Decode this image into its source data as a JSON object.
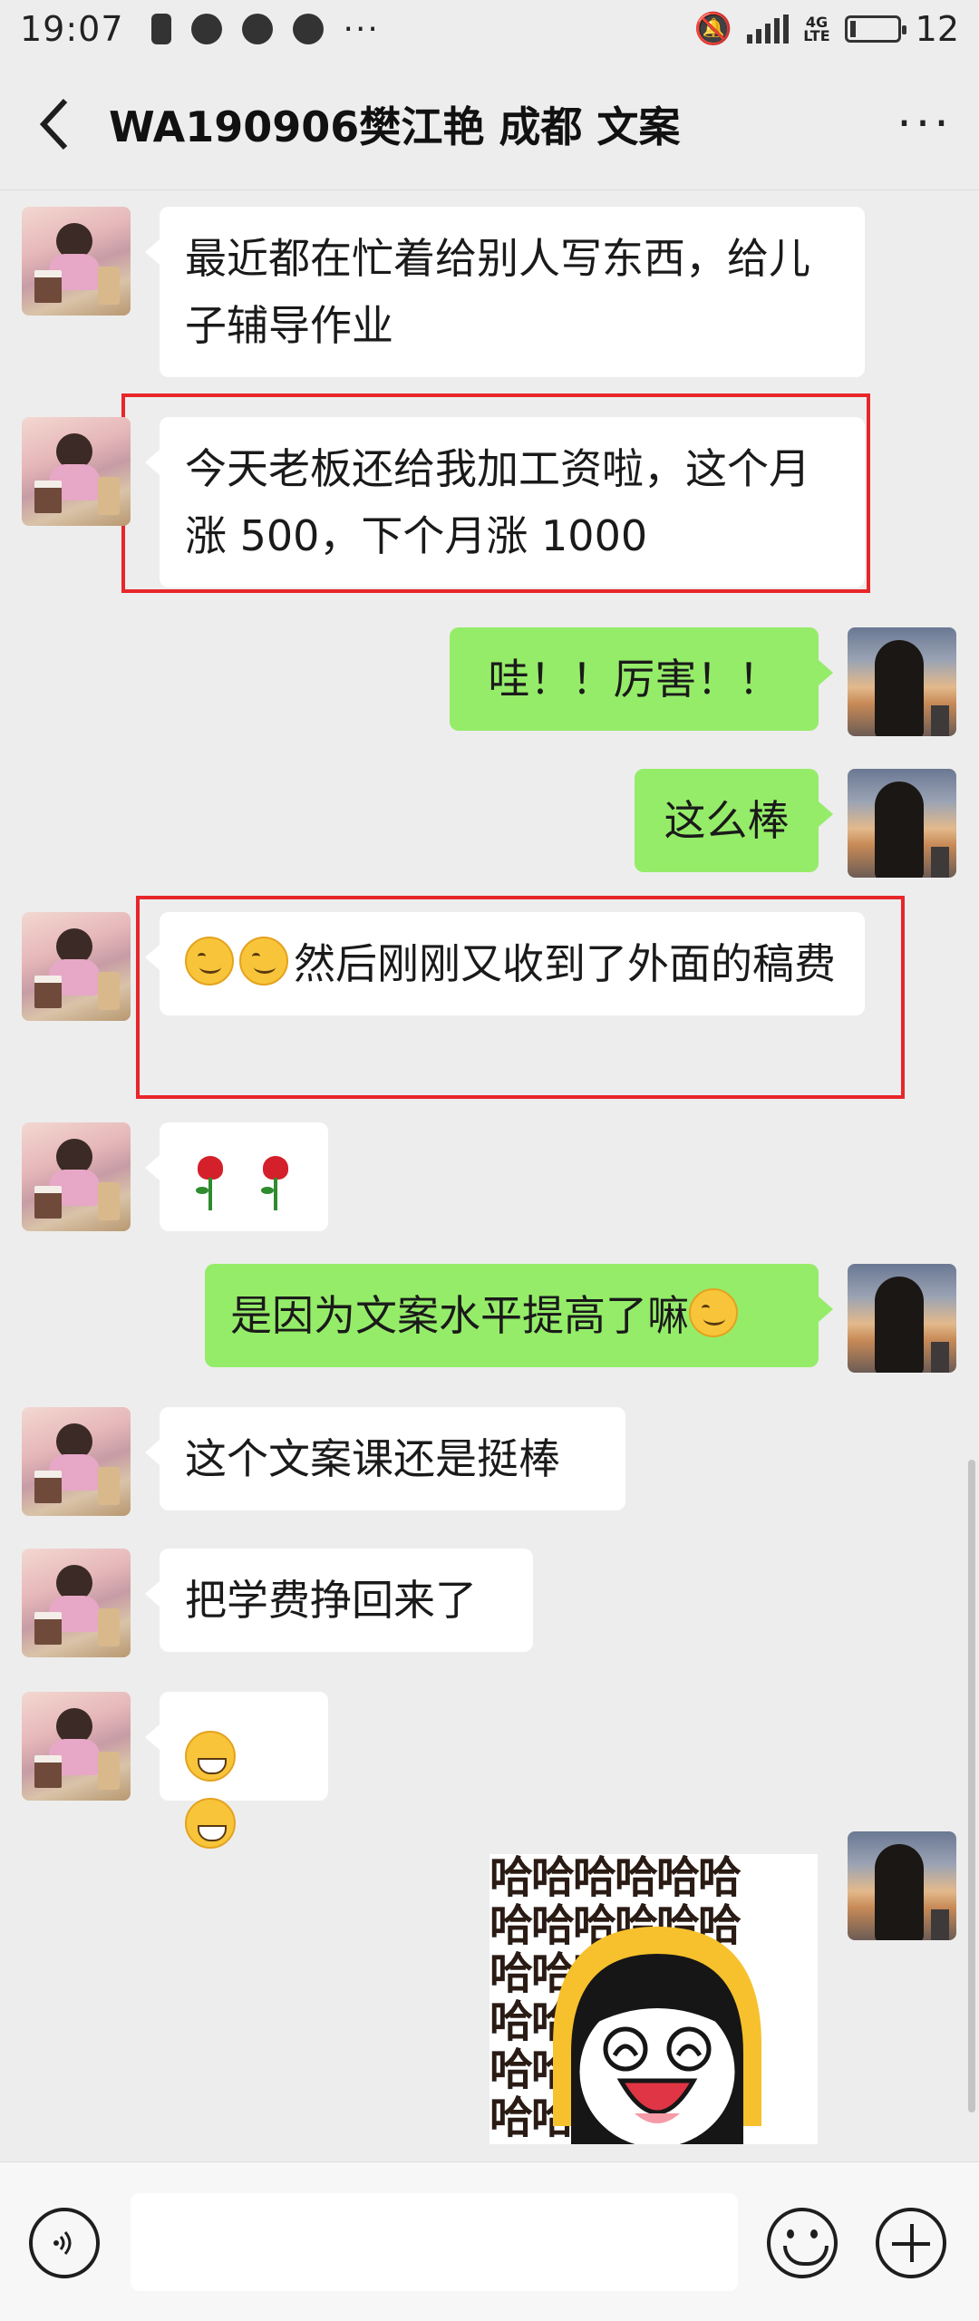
{
  "status_bar": {
    "time": "19:07",
    "network": "4G",
    "battery_label": "12",
    "battery_level": 0.12
  },
  "header": {
    "title": "WA190906樊江艳 成都 文案"
  },
  "messages": [
    {
      "side": "left",
      "text": "最近都在忙着给别人写东西，给儿子辅导作业"
    },
    {
      "side": "left",
      "text": "今天老板还给我加工资啦，这个月涨 500，下个月涨 1000",
      "highlighted": true
    },
    {
      "side": "right",
      "text": "哇！！厉害！！"
    },
    {
      "side": "right",
      "text": "这么棒"
    },
    {
      "side": "left",
      "text": "然后刚刚又收到了外面的稿费",
      "emoji_prefix": [
        "smiling-face-icon",
        "smiling-face-icon"
      ],
      "highlighted": true
    },
    {
      "side": "left",
      "emoji_only": [
        "rose-icon",
        "rose-icon"
      ]
    },
    {
      "side": "right",
      "text": "是因为文案水平提高了嘛",
      "emoji_suffix": "smirk-face-icon"
    },
    {
      "side": "left",
      "text": "这个文案课还是挺棒"
    },
    {
      "side": "left",
      "text": "把学费挣回来了"
    },
    {
      "side": "left",
      "emoji_only": [
        "grinning-face-icon",
        "grinning-face-icon"
      ]
    },
    {
      "side": "right",
      "sticker": "laughing-girl-sticker",
      "sticker_text": "哈哈哈哈哈哈"
    }
  ],
  "colors": {
    "background": "#ededed",
    "incoming_bubble": "#ffffff",
    "outgoing_bubble": "#95ec69",
    "highlight_border": "#e8262a"
  },
  "input_bar": {
    "icons": [
      "voice-icon",
      "emoji-icon",
      "plus-icon"
    ]
  }
}
